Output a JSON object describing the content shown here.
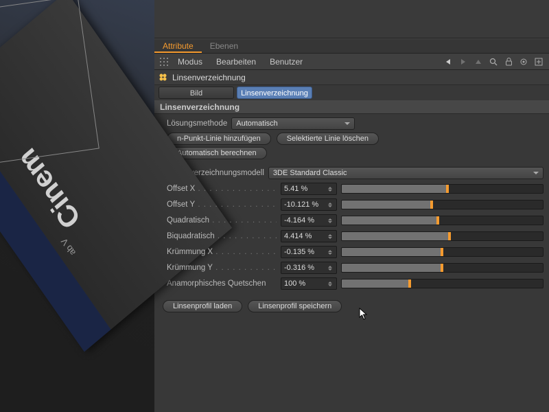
{
  "tabs": {
    "attribute": "Attribute",
    "ebenen": "Ebenen"
  },
  "menubar": {
    "modus": "Modus",
    "bearbeiten": "Bearbeiten",
    "benutzer": "Benutzer"
  },
  "section_title": "Linsenverzeichnung",
  "subtabs": {
    "bild": "Bild",
    "linsenverzeichnung": "Linsenverzeichnung"
  },
  "group_title": "Linsenverzeichnung",
  "labels": {
    "solve_method": "Lösungsmethode",
    "model": "Linsenverzeichnungsmodell",
    "offset_x": "Offset X",
    "offset_y": "Offset Y",
    "quadratic": "Quadratisch",
    "biquadratic": "Biquadratisch",
    "curve_x": "Krümmung X",
    "curve_y": "Krümmung Y",
    "anamorphic": "Anamorphisches Quetschen"
  },
  "values": {
    "solve_method": "Automatisch",
    "model": "3DE Standard Classic",
    "offset_x": "5.41 %",
    "offset_y": "-10.121 %",
    "quadratic": "-4.164 %",
    "biquadratic": "4.414 %",
    "curve_x": "-0.135 %",
    "curve_y": "-0.316 %",
    "anamorphic": "100 %"
  },
  "buttons": {
    "add_npoint": "n-Punkt-Linie hinzufügen",
    "delete_selected": "Selektierte Linie löschen",
    "auto_calc": "Automatisch berechnen",
    "load_profile": "Linsenprofil laden",
    "save_profile": "Linsenprofil speichern"
  },
  "sliders": {
    "offset_x": {
      "fill": 52,
      "mark": 52
    },
    "offset_y": {
      "fill": 44,
      "mark": 44
    },
    "quadratic": {
      "fill": 47,
      "mark": 47
    },
    "biquadratic": {
      "fill": 53,
      "mark": 53
    },
    "curve_x": {
      "fill": 49,
      "mark": 49
    },
    "curve_y": {
      "fill": 49,
      "mark": 49
    },
    "anamorphic": {
      "fill": 33,
      "mark": 33
    }
  },
  "colors": {
    "accent": "#f59b2f",
    "selected": "#5a7fb5"
  }
}
